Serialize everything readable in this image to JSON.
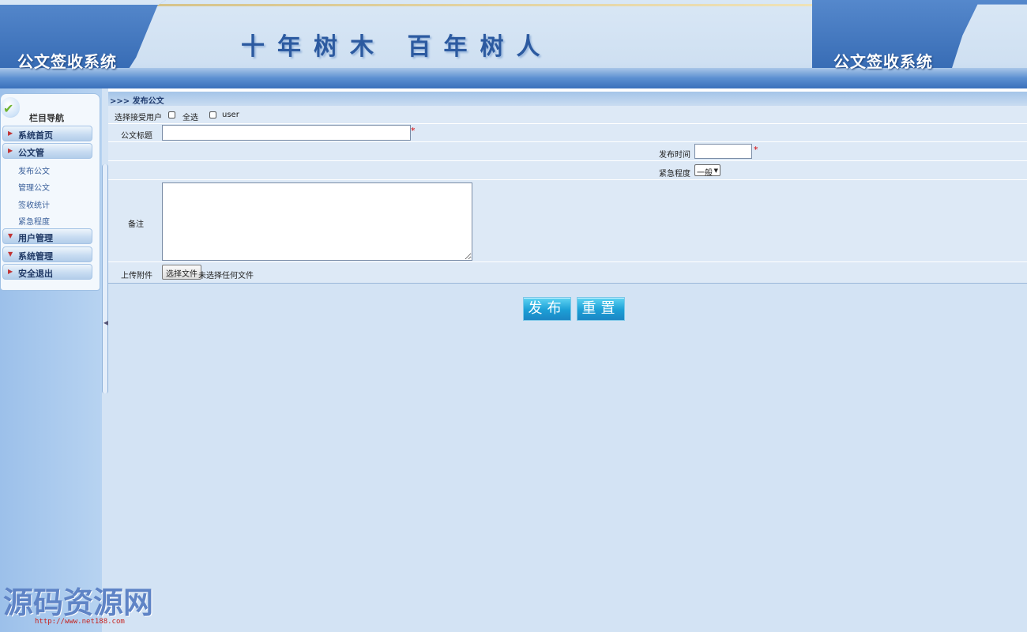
{
  "header": {
    "system_name_left": "公文签收系统",
    "slogan": "十年树木 百年树人",
    "system_name_right": "公文签收系统"
  },
  "sidebar": {
    "title": "栏目导航",
    "items": [
      {
        "label": "系统首页"
      },
      {
        "label": "公文管"
      },
      {
        "label": "用户管理"
      },
      {
        "label": "系统管理"
      },
      {
        "label": "安全退出"
      }
    ],
    "subitems": [
      {
        "label": "发布公文"
      },
      {
        "label": "管理公文"
      },
      {
        "label": "签收统计"
      },
      {
        "label": "紧急程度"
      }
    ]
  },
  "breadcrumb": ">>> 发布公文",
  "form": {
    "recipients_label": "选择接受用户",
    "select_all_label": "全选",
    "user_option_label": "user",
    "title_label": "公文标题",
    "title_value": "",
    "required_mark": "*",
    "publish_time_label": "发布时间",
    "publish_time_value": "",
    "urgency_label": "紧急程度",
    "urgency_selected": "一般",
    "remarks_label": "备注",
    "remarks_value": "",
    "attachment_label": "上传附件",
    "choose_file_label": "选择文件",
    "no_file_text": "未选择任何文件"
  },
  "actions": {
    "publish_label": "发布",
    "reset_label": "重置"
  },
  "watermark": {
    "text": "源码资源网",
    "url": "http://www.net188.com"
  },
  "colors": {
    "header_blue": "#3a70bb",
    "background": "#d3e3f4",
    "button_cyan": "#1c9fd6",
    "required_red": "#d60000"
  }
}
